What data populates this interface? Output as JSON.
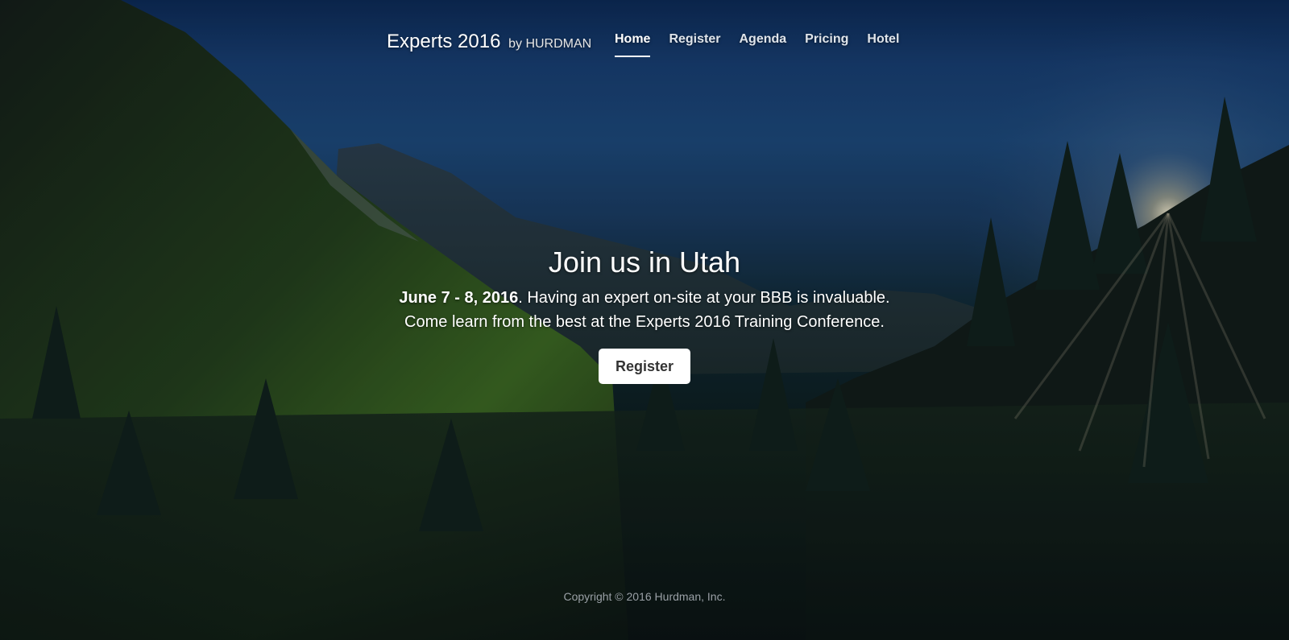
{
  "brand": {
    "title": "Experts 2016",
    "byline": "by HURDMAN"
  },
  "nav": {
    "items": [
      {
        "label": "Home",
        "active": true
      },
      {
        "label": "Register",
        "active": false
      },
      {
        "label": "Agenda",
        "active": false
      },
      {
        "label": "Pricing",
        "active": false
      },
      {
        "label": "Hotel",
        "active": false
      }
    ]
  },
  "hero": {
    "heading": "Join us in Utah",
    "date": "June 7 - 8, 2016",
    "line1_rest": ". Having an expert on-site at your BBB is invaluable.",
    "line2": "Come learn from the best at the Experts 2016 Training Conference.",
    "button_label": "Register"
  },
  "footer": {
    "copyright": "Copyright © 2016 Hurdman, Inc."
  },
  "colors": {
    "sky": "#1d4a7c",
    "forest": "#0d1e1f",
    "text": "#ffffff",
    "button_bg": "#ffffff",
    "button_text": "#333333"
  }
}
